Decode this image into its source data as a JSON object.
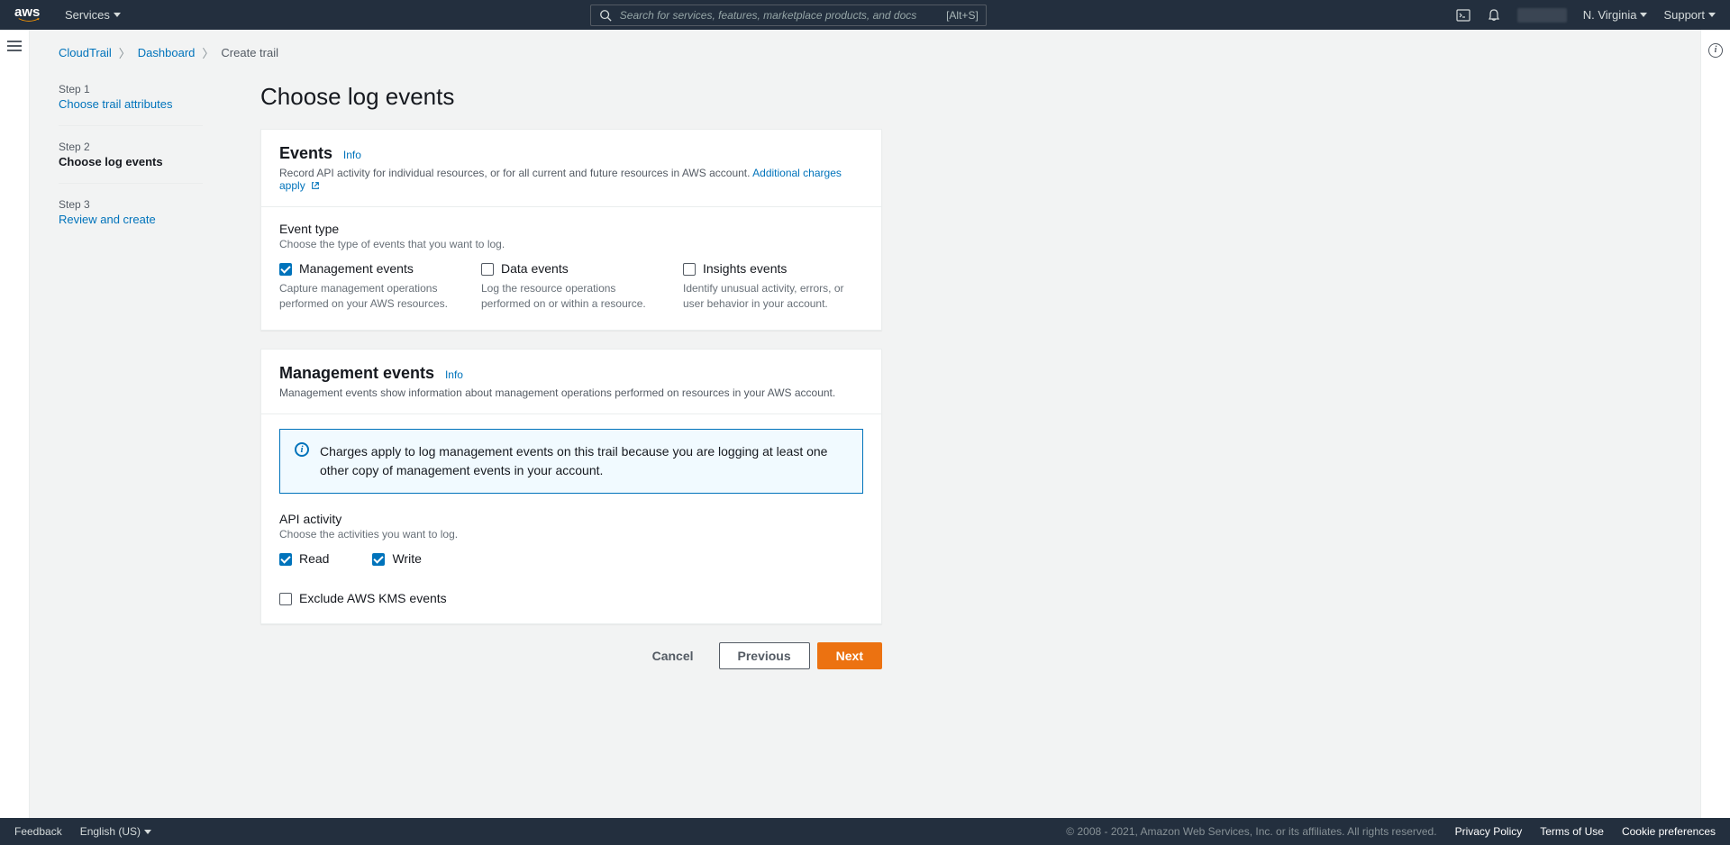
{
  "topnav": {
    "services": "Services",
    "search_placeholder": "Search for services, features, marketplace products, and docs",
    "search_shortcut": "[Alt+S]",
    "region": "N. Virginia",
    "support": "Support"
  },
  "breadcrumb": {
    "service": "CloudTrail",
    "dashboard": "Dashboard",
    "current": "Create trail"
  },
  "steps": {
    "step1_n": "Step 1",
    "step1_label": "Choose trail attributes",
    "step2_n": "Step 2",
    "step2_label": "Choose log events",
    "step3_n": "Step 3",
    "step3_label": "Review and create"
  },
  "page_title": "Choose log events",
  "events_panel": {
    "title": "Events",
    "info": "Info",
    "desc": "Record API activity for individual resources, or for all current and future resources in AWS account.",
    "charges_link": "Additional charges apply",
    "event_type_label": "Event type",
    "event_type_help": "Choose the type of events that you want to log.",
    "mgmt_label": "Management events",
    "mgmt_desc": "Capture management operations performed on your AWS resources.",
    "data_label": "Data events",
    "data_desc": "Log the resource operations performed on or within a resource.",
    "insights_label": "Insights events",
    "insights_desc": "Identify unusual activity, errors, or user behavior in your account."
  },
  "mgmt_panel": {
    "title": "Management events",
    "info": "Info",
    "desc": "Management events show information about management operations performed on resources in your AWS account.",
    "alert": "Charges apply to log management events on this trail because you are logging at least one other copy of management events in your account.",
    "api_label": "API activity",
    "api_help": "Choose the activities you want to log.",
    "read": "Read",
    "write": "Write",
    "exclude_kms": "Exclude AWS KMS events"
  },
  "actions": {
    "cancel": "Cancel",
    "previous": "Previous",
    "next": "Next"
  },
  "footer": {
    "feedback": "Feedback",
    "language": "English (US)",
    "copyright": "© 2008 - 2021, Amazon Web Services, Inc. or its affiliates. All rights reserved.",
    "privacy": "Privacy Policy",
    "terms": "Terms of Use",
    "cookies": "Cookie preferences"
  }
}
